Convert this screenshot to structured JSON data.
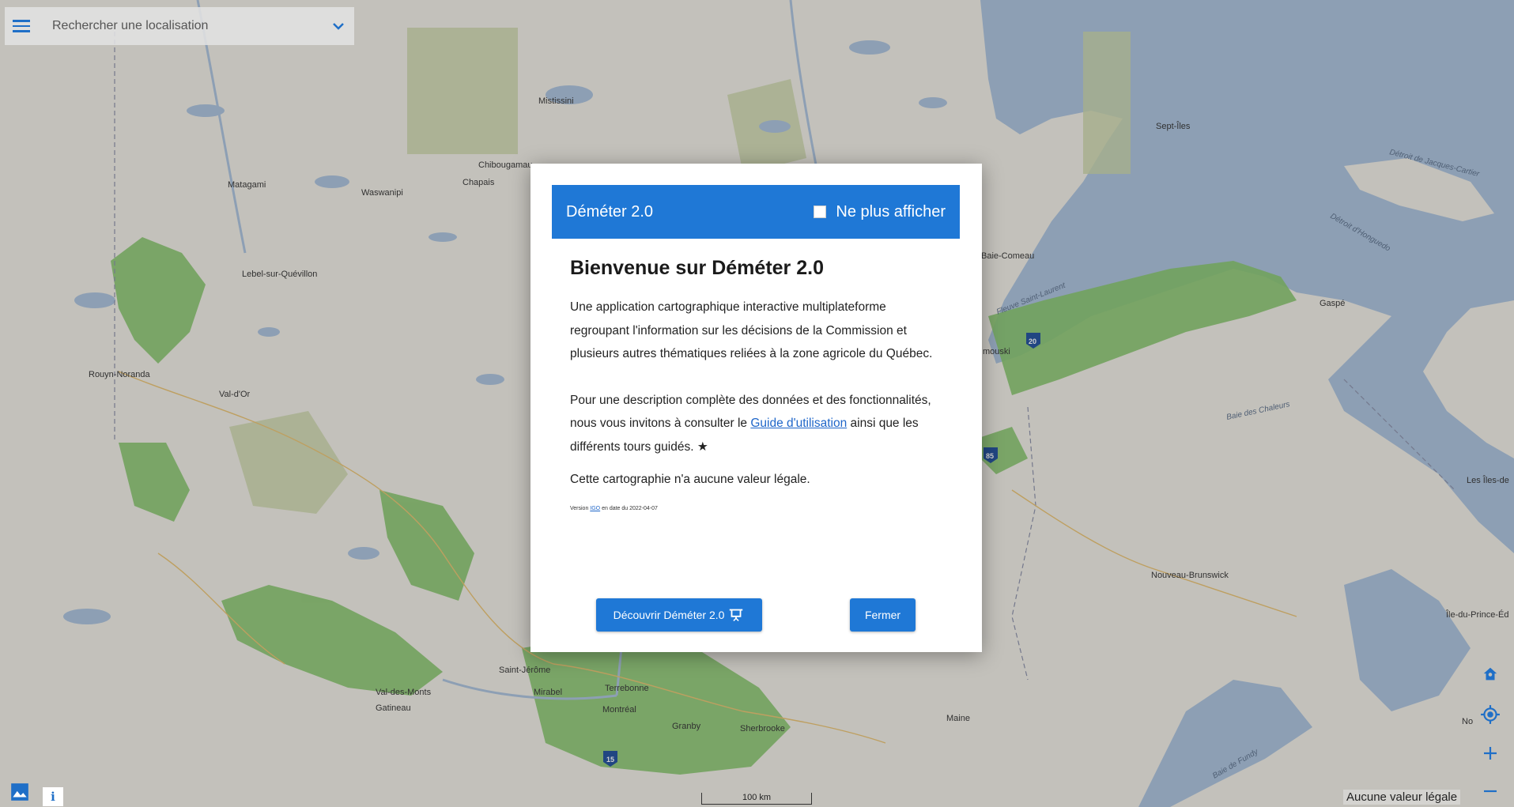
{
  "search": {
    "placeholder": "Rechercher une localisation"
  },
  "modal": {
    "title": "Déméter 2.0",
    "no_show_label": "Ne plus afficher",
    "heading": "Bienvenue sur Déméter 2.0",
    "para1": "Une application cartographique interactive multiplateforme regroupant l'information sur les décisions de la Commission et plusieurs autres thématiques reliées à la zone agricole du Québec.",
    "para2_before": "Pour une description complète des données et des fonctionnalités, nous vous invitons à consulter le ",
    "para2_link": "Guide d'utilisation",
    "para2_after": " ainsi que les différents tours guidés. ★",
    "legal_text": "Cette cartographie n'a aucune valeur légale.",
    "version_before": "Version ",
    "version_link": "IGO",
    "version_after": " en date du 2022-04-07",
    "discover_label": "Découvrir Déméter 2.0",
    "close_label": "Fermer"
  },
  "map": {
    "scale_label": "100 km",
    "disclaimer": "Aucune valeur légale",
    "places": [
      "Mistissini",
      "Chibougamau",
      "Chapais",
      "Waswanipi",
      "Matagami",
      "Lebel-sur-Quévillon",
      "Rouyn-Noranda",
      "Val-d'Or",
      "Sept-Îles",
      "Baie-Comeau",
      "Gaspé",
      "Rimouski",
      "Saint-Jérôme",
      "Mirabel",
      "Terrebonne",
      "Montréal",
      "Gatineau",
      "Val-des-Monts",
      "Granby",
      "Sherbrooke",
      "Maine",
      "Nouveau-Brunswick",
      "Les Îles-de",
      "Île-du-Prince-Éd",
      "No"
    ],
    "water_labels": [
      "Détroit de Jacques-Cartier",
      "Détroit d'Honguedo",
      "Fleuve Saint-Laurent",
      "Baie des Chaleurs",
      "Baie de Fundy"
    ],
    "shields": [
      "20",
      "85",
      "15"
    ]
  },
  "colors": {
    "accent": "#1f78d6",
    "water": "#a9c1dc",
    "land": "#f1efe9",
    "agri": "#7fc06a"
  },
  "icons": [
    "menu-icon",
    "chevron-down-icon",
    "home-icon",
    "locate-icon",
    "plus-icon",
    "minus-icon",
    "layers-image-icon",
    "info-icon",
    "presentation-icon"
  ]
}
